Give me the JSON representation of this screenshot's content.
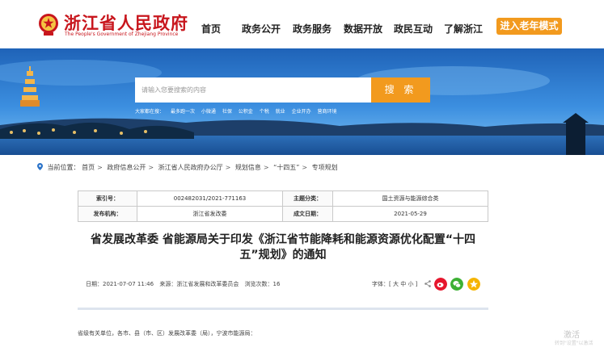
{
  "header": {
    "site_title": "浙江省人民政府",
    "site_subtitle": "The People's Government of Zhejiang Province",
    "nav": [
      "首页",
      "政务公开",
      "政务服务",
      "数据开放",
      "政民互动",
      "了解浙江"
    ],
    "elder_mode": "进入老年模式"
  },
  "search": {
    "placeholder": "请输入您要搜索的内容",
    "button": "搜 索",
    "hot_label": "大家都在搜：",
    "hot_terms": [
      "最多跑一次",
      "小微通",
      "社保",
      "公积金",
      "个税",
      "就业",
      "企业开办",
      "营商环境"
    ]
  },
  "breadcrumb": {
    "prefix": "当前位置：",
    "items": [
      "首页",
      "政府信息公开",
      "浙江省人民政府办公厅",
      "规划信息",
      "“十四五”",
      "专项规划"
    ]
  },
  "meta": {
    "index_label": "索引号：",
    "index_value": "002482031/2021-771163",
    "topic_label": "主题分类：",
    "topic_value": "国土资源与能源综合类",
    "issuer_label": "发布机构：",
    "issuer_value": "浙江省发改委",
    "date_label": "成文日期：",
    "date_value": "2021-05-29"
  },
  "article": {
    "title": "省发展改革委 省能源局关于印发《浙江省节能降耗和能源资源优化配置“十四五”规划》的通知",
    "date": "日期：2021-07-07 11:46",
    "source": "来源：浙江省发展和改革委员会",
    "views": "浏览次数：16",
    "font_label": "字体：[",
    "font_large": "大",
    "font_medium": "中",
    "font_small": "小",
    "font_end": "]",
    "addressee": "省级有关单位，各市、县（市、区）发展改革委（局），宁波市能源局："
  },
  "watermark": {
    "text": "激活",
    "sub": "转到\"设置\"以激活"
  },
  "colors": {
    "brand_red": "#c8161d",
    "accent_orange": "#f29a1e",
    "weibo": "#e6162d",
    "wechat": "#3cb034",
    "qzone": "#f5b400"
  }
}
